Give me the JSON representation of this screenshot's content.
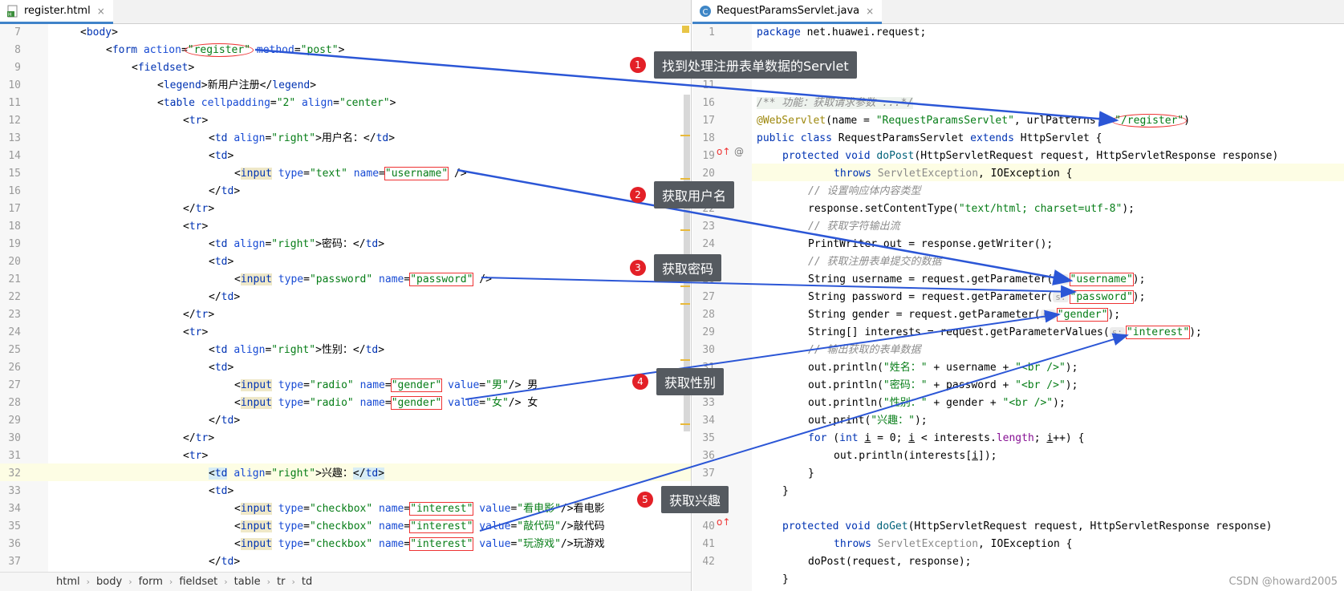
{
  "left_tab": {
    "title": "register.html",
    "close": "×"
  },
  "right_tab": {
    "title": "RequestParamsServlet.java",
    "close": "×"
  },
  "left_lines": [
    "7",
    "8",
    "9",
    "10",
    "11",
    "12",
    "13",
    "14",
    "15",
    "16",
    "17",
    "18",
    "19",
    "20",
    "21",
    "22",
    "23",
    "24",
    "25",
    "26",
    "27",
    "28",
    "29",
    "30",
    "31",
    "32",
    "33",
    "34",
    "35",
    "36",
    "37"
  ],
  "right_lines": [
    "1",
    "",
    "10",
    "11",
    "16",
    "17",
    "18",
    "19",
    "20",
    "21",
    "22",
    "23",
    "24",
    "25",
    "26",
    "27",
    "28",
    "29",
    "30",
    "31",
    "32",
    "33",
    "34",
    "35",
    "36",
    "37",
    "",
    "39",
    "40",
    "41",
    "42"
  ],
  "html": {
    "l7_body": "body",
    "l8_form": "form",
    "l8_action_attr": "action",
    "l8_action_val": "\"register\"",
    "l8_method_attr": "method",
    "l8_method_val": "\"post\"",
    "l9_fieldset": "fieldset",
    "l10_legend": "legend",
    "l10_text": "新用户注册",
    "l11_table": "table",
    "l11_cellpadding": "cellpadding",
    "l11_cp_val": "\"2\"",
    "l11_align": "align",
    "l11_align_val": "\"center\"",
    "tr": "tr",
    "td": "td",
    "input": "input",
    "align": "align",
    "right_val": "\"right\"",
    "type": "type",
    "name": "name",
    "value": "value",
    "l13_text": "用户名：",
    "text_val": "\"text\"",
    "username_val": "\"username\"",
    "l19_text": "密码：",
    "password_type": "\"password\"",
    "password_val": "\"password\"",
    "l25_text": "性别：",
    "radio_val": "\"radio\"",
    "gender_val": "\"gender\"",
    "male_val": "\"男\"",
    "male_text": " 男",
    "female_val": "\"女\"",
    "female_text": " 女",
    "l32_text": "兴趣：",
    "checkbox_val": "\"checkbox\"",
    "interest_val": "\"interest\"",
    "movie_val": "\"看电影\"",
    "movie_text": "看电影",
    "code_val": "\"敲代码\"",
    "code_text": "敲代码",
    "game_val": "\"玩游戏\"",
    "game_text": "玩游戏"
  },
  "java": {
    "package_kw": "package",
    "package_name": " net.huawei.request;",
    "doc_comment": "/** 功能：获取请求参数 ...*/",
    "annotation": "@WebServlet",
    "anno_open": "(name = ",
    "anno_name_val": "\"RequestParamsServlet\"",
    "anno_mid": ", urlPatterns = ",
    "anno_url_val": "\"/register\"",
    "anno_close": ")",
    "class_public": "public",
    "class_kw": "class",
    "class_name": " RequestParamsServlet ",
    "extends_kw": "extends",
    "class_tail": " HttpServlet {",
    "protected": "protected",
    "void": "void",
    "dopost": "doPost",
    "dopost_params": "(HttpServletRequest request, HttpServletResponse response)",
    "throws": "throws",
    "servlet_exc": " ServletException",
    "exc_tail": ", IOException {",
    "c_content_type": "// 设置响应体内容类型",
    "set_ct": "response.setContentType(",
    "ct_val": "\"text/html; charset=utf-8\"",
    "stmt_end": ");",
    "c_writer": "// 获取字符输出流",
    "writer_line": "PrintWriter out = response.getWriter();",
    "c_params": "// 获取注册表单提交的数据",
    "un_line": "String username = request.getParameter(",
    "pw_line": "String password = request.getParameter(",
    "gd_line": "String gender = request.getParameter(",
    "in_line": "String[] interests = request.getParameterValues(",
    "hint_s": "s:",
    "p_username": "\"username\"",
    "p_password": "\"password\"",
    "p_gender": "\"gender\"",
    "p_interest": "\"interest\"",
    "c_output": "// 输出获取的表单数据",
    "println_open": "out.println(",
    "print_open": "out.print(",
    "name_label": "\"姓名：\"",
    "pwd_label": "\"密码：\"",
    "gender_label": "\"性别：\"",
    "interest_label": "\"兴趣：\"",
    "plus_username": " + username + ",
    "plus_password": " + password + ",
    "plus_gender": " + gender + ",
    "br_val": "\"<br />\"",
    "for_kw": "for",
    "for_int": "int",
    "for_i": "i",
    "for_a": " (",
    "for_b": " = 0; ",
    "for_c": " < interests.",
    "length": "length",
    "for_d": "; ",
    "for_e": "++) {",
    "for_body_a": "out.println(interests[",
    "for_body_b": "]);",
    "brace_close": "}",
    "doget": "doGet",
    "doget_params": "(HttpServletRequest request, HttpServletResponse response)",
    "dopost_call": "doPost(request, response);"
  },
  "breadcrumb": [
    "html",
    "body",
    "form",
    "fieldset",
    "table",
    "tr",
    "td"
  ],
  "callouts": [
    {
      "num": "1",
      "text": "找到处理注册表单数据的Servlet"
    },
    {
      "num": "2",
      "text": "获取用户名"
    },
    {
      "num": "3",
      "text": "获取密码"
    },
    {
      "num": "4",
      "text": "获取性别"
    },
    {
      "num": "5",
      "text": "获取兴趣"
    }
  ],
  "watermark": "CSDN @howard2005",
  "colors": {
    "arrow": "#2b56d6",
    "callout_bg": "#555a60",
    "badge": "#e32027",
    "box": "#ee3333"
  }
}
